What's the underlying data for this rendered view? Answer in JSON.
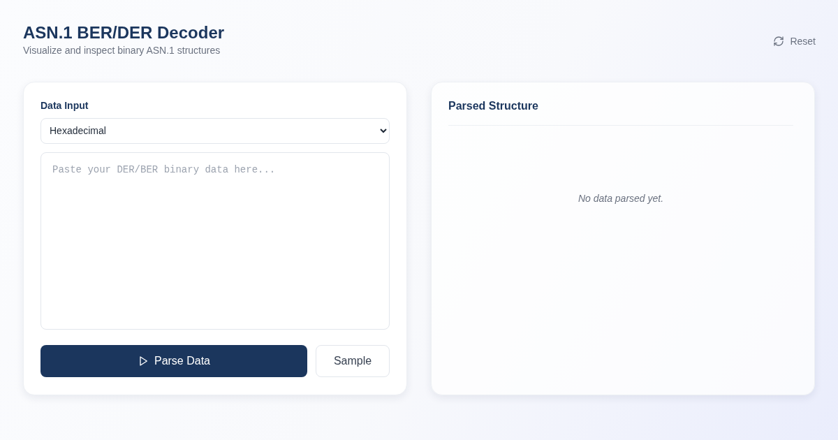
{
  "header": {
    "title": "ASN.1 BER/DER Decoder",
    "subtitle": "Visualize and inspect binary ASN.1 structures",
    "reset_button": "Reset"
  },
  "input_panel": {
    "label": "Data Input",
    "format_select": "Hexadecimal",
    "data_field": {
      "placeholder": "Paste your DER/BER binary data here..."
    },
    "parse_button": "Parse Data",
    "sample_button": "Sample"
  },
  "output_panel": {
    "title": "Parsed Structure",
    "empty_message": "No data parsed yet."
  }
}
